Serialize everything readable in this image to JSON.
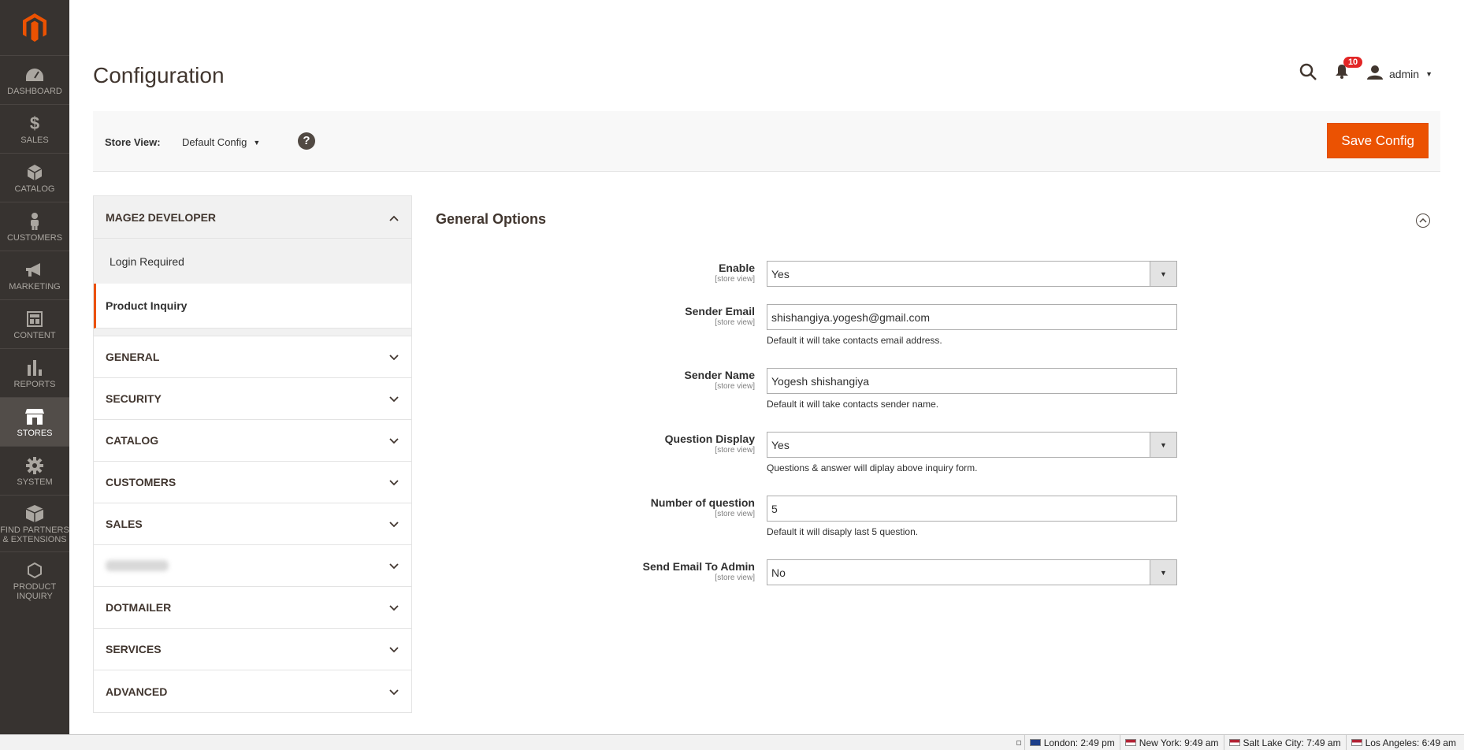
{
  "sidebar": {
    "items": [
      {
        "label": "DASHBOARD",
        "icon": "dashboard-icon"
      },
      {
        "label": "SALES",
        "icon": "dollar-icon"
      },
      {
        "label": "CATALOG",
        "icon": "box-icon"
      },
      {
        "label": "CUSTOMERS",
        "icon": "person-icon"
      },
      {
        "label": "MARKETING",
        "icon": "megaphone-icon"
      },
      {
        "label": "CONTENT",
        "icon": "layout-icon"
      },
      {
        "label": "REPORTS",
        "icon": "bar-chart-icon"
      },
      {
        "label": "STORES",
        "icon": "store-icon"
      },
      {
        "label": "SYSTEM",
        "icon": "gear-icon"
      },
      {
        "label": "FIND PARTNERS & EXTENSIONS",
        "icon": "partners-icon"
      },
      {
        "label": "PRODUCT INQUIRY",
        "icon": "hexagon-icon"
      }
    ]
  },
  "header": {
    "title": "Configuration",
    "notifications_count": "10",
    "user": "admin"
  },
  "store_bar": {
    "label": "Store View:",
    "value": "Default Config",
    "help": "?",
    "save_label": "Save Config"
  },
  "tabs": {
    "group_title": "MAGE2 DEVELOPER",
    "links": [
      "Login Required",
      "Product Inquiry"
    ],
    "sections": [
      "GENERAL",
      "SECURITY",
      "CATALOG",
      "CUSTOMERS",
      "SALES",
      "",
      "DOTMAILER",
      "SERVICES",
      "ADVANCED"
    ]
  },
  "form": {
    "section_title": "General Options",
    "scope": "[store view]",
    "fields": [
      {
        "label": "Enable",
        "value": "Yes",
        "note": ""
      },
      {
        "label": "Sender Email",
        "value": "shishangiya.yogesh@gmail.com",
        "note": "Default it will take contacts email address."
      },
      {
        "label": "Sender Name",
        "value": "Yogesh shishangiya",
        "note": "Default it will take contacts sender name."
      },
      {
        "label": "Question Display",
        "value": "Yes",
        "note": "Questions & answer will diplay above inquiry form."
      },
      {
        "label": "Number of question",
        "value": "5",
        "note": "Default it will disaply last 5 question."
      },
      {
        "label": "Send Email To Admin",
        "value": "No",
        "note": ""
      }
    ]
  },
  "footer": {
    "clocks": [
      "London: 2:49 pm",
      "New York: 9:49 am",
      "Salt Lake City: 7:49 am",
      "Los Angeles: 6:49 am"
    ]
  },
  "colors": {
    "accent": "#eb5202",
    "sidebar_bg": "#373330",
    "badge": "#e22626"
  }
}
